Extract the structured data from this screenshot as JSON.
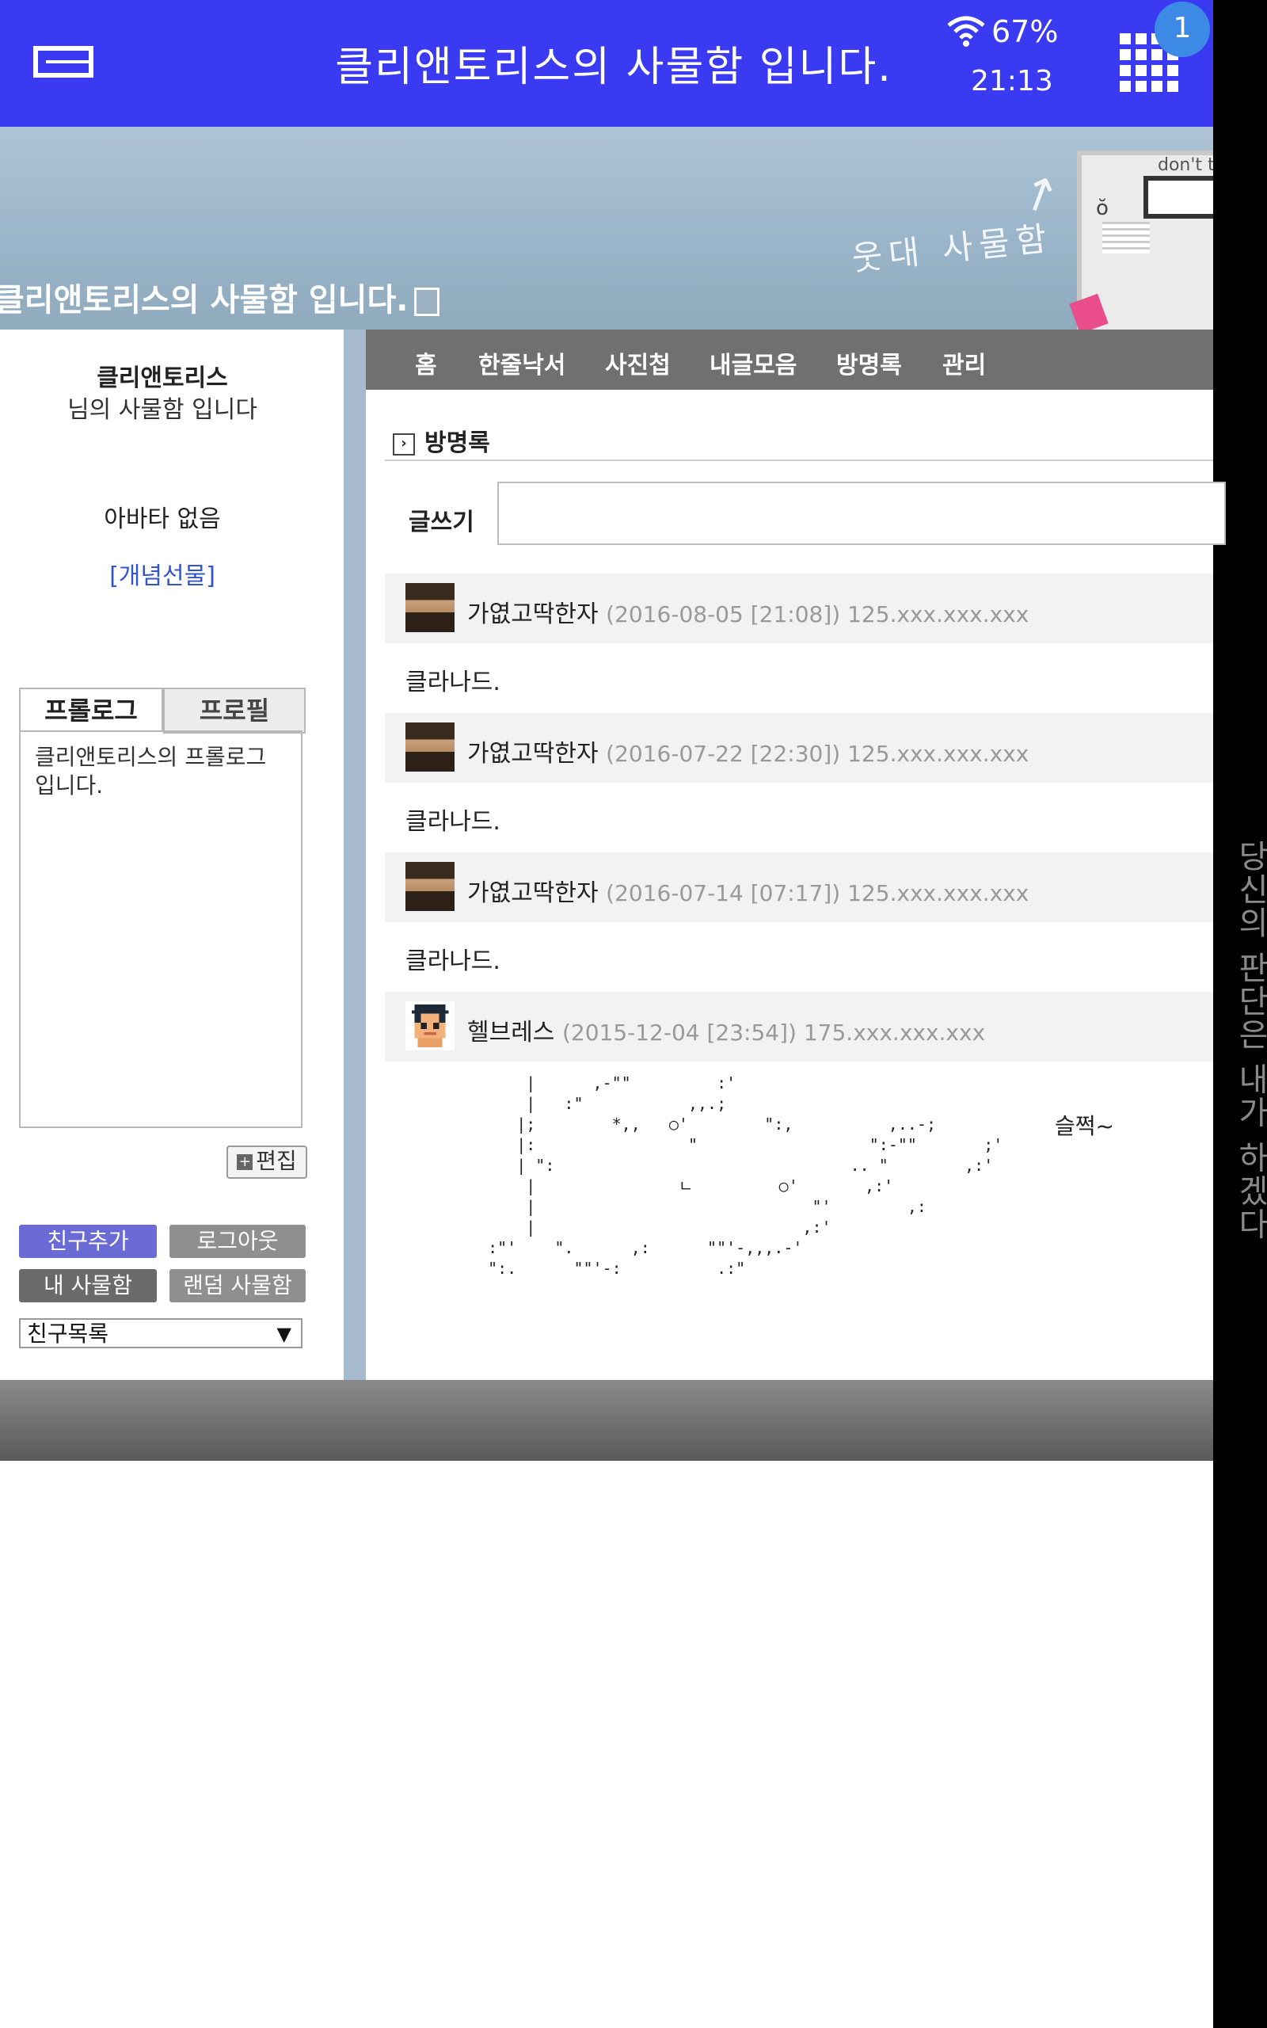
{
  "status_bar": {
    "title": "클리앤토리스의 사물함 입니다.",
    "battery": "67%",
    "time": "21:13",
    "notification_count": "1"
  },
  "side_strip": {
    "text": "당신의 판단은 내가 하겠다"
  },
  "banner": {
    "title": "클리앤토리스의 사물함 입니다.",
    "handwriting": "웃대 사물함",
    "locker_note": "don't t"
  },
  "sidebar": {
    "owner_name": "클리앤토리스",
    "owner_sub": "님의 사물함 입니다",
    "avatar_text": "아바타 없음",
    "gift_link": "[개념선물]",
    "tabs": [
      {
        "label": "프롤로그"
      },
      {
        "label": "프로필"
      }
    ],
    "prologue_text": "클리앤토리스의 프롤로그 입니다.",
    "edit_label": "편집",
    "buttons": {
      "add_friend": "친구추가",
      "logout": "로그아웃",
      "my_locker": "내 사물함",
      "random_locker": "랜덤 사물함"
    },
    "friend_select": "친구목록",
    "colors": {
      "add_friend": "#6b6bd6",
      "gray": "#8f8f8f",
      "dark": "#6a6a6a"
    }
  },
  "nav": {
    "items": [
      "홈",
      "한줄낙서",
      "사진첩",
      "내글모음",
      "방명록",
      "관리"
    ]
  },
  "guestbook": {
    "section_title": "방명록",
    "write_label": "글쓰기",
    "entries": [
      {
        "author": "가엾고딱한자",
        "meta": "(2016-08-05 [21:08]) 125.xxx.xxx.xxx",
        "body": "클라나드.",
        "avatar": "king-avatar"
      },
      {
        "author": "가엾고딱한자",
        "meta": "(2016-07-22 [22:30]) 125.xxx.xxx.xxx",
        "body": "클라나드.",
        "avatar": "king-avatar"
      },
      {
        "author": "가엾고딱한자",
        "meta": "(2016-07-14 [07:17]) 125.xxx.xxx.xxx",
        "body": "클라나드.",
        "avatar": "king-avatar"
      },
      {
        "author": "헬브레스",
        "meta": "(2015-12-04 [23:54]) 175.xxx.xxx.xxx",
        "body": "슬쩍~",
        "avatar": "pixel-avatar"
      }
    ],
    "ascii_art": "      |      ,-\"\"         :'\n      |   :\"           ,,.;\n     |;        *,,   ○'        \":,          ,..-;\n     |:                \"                  \":-\"\"       ;'\n     | \":                               .. \"        ,:'\n      |               ㄴ         ○'       ,:'\n      |                             \"'        ,:\n      |                            ,:'\n  :\"'    \".      ,:      \"\"'-,,,.-'\n  \":.      \"\"'-:          .:\""
  }
}
